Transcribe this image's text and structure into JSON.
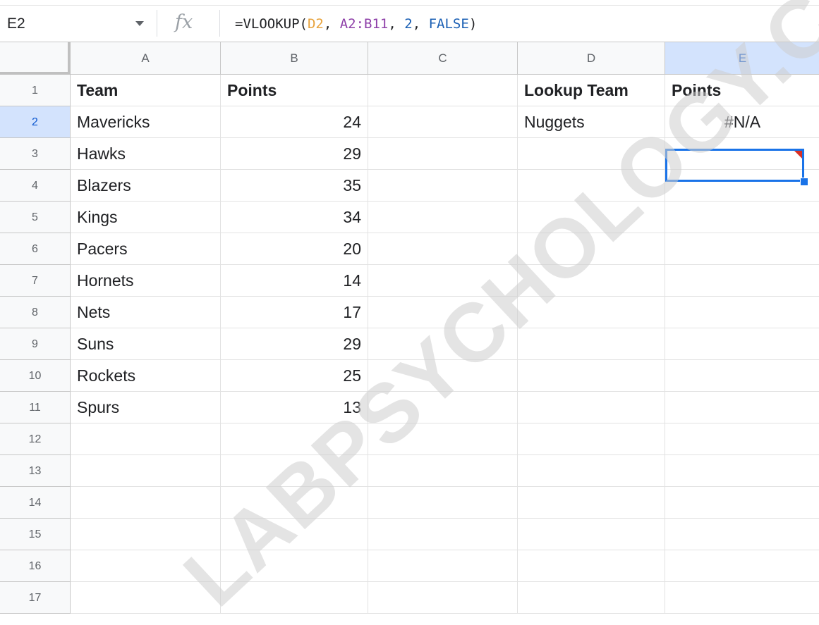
{
  "formula_bar": {
    "name_box": "E2",
    "fx_label": "fx",
    "formula_parts": [
      {
        "text": "=VLOOKUP(",
        "color": "#202124"
      },
      {
        "text": "D2",
        "color": "#e8a33d"
      },
      {
        "text": ", ",
        "color": "#202124"
      },
      {
        "text": "A2:B11",
        "color": "#8e3fa8"
      },
      {
        "text": ", ",
        "color": "#202124"
      },
      {
        "text": "2",
        "color": "#1a5fb4"
      },
      {
        "text": ", ",
        "color": "#202124"
      },
      {
        "text": "FALSE",
        "color": "#1a5fb4"
      },
      {
        "text": ")",
        "color": "#202124"
      }
    ]
  },
  "sheet": {
    "columns": [
      "A",
      "B",
      "C",
      "D",
      "E"
    ],
    "active_column": "E",
    "active_row": 2,
    "rows": [
      {
        "num": "1",
        "A": "Team",
        "B": "Points",
        "C": "",
        "D": "Lookup Team",
        "E": "Points"
      },
      {
        "num": "2",
        "A": "Mavericks",
        "B": "24",
        "C": "",
        "D": "Nuggets",
        "E": "#N/A"
      },
      {
        "num": "3",
        "A": "Hawks",
        "B": "29",
        "C": "",
        "D": "",
        "E": ""
      },
      {
        "num": "4",
        "A": "Blazers",
        "B": "35",
        "C": "",
        "D": "",
        "E": ""
      },
      {
        "num": "5",
        "A": "Kings",
        "B": "34",
        "C": "",
        "D": "",
        "E": ""
      },
      {
        "num": "6",
        "A": "Pacers",
        "B": "20",
        "C": "",
        "D": "",
        "E": ""
      },
      {
        "num": "7",
        "A": "Hornets",
        "B": "14",
        "C": "",
        "D": "",
        "E": ""
      },
      {
        "num": "8",
        "A": "Nets",
        "B": "17",
        "C": "",
        "D": "",
        "E": ""
      },
      {
        "num": "9",
        "A": "Suns",
        "B": "29",
        "C": "",
        "D": "",
        "E": ""
      },
      {
        "num": "10",
        "A": "Rockets",
        "B": "25",
        "C": "",
        "D": "",
        "E": ""
      },
      {
        "num": "11",
        "A": "Spurs",
        "B": "13",
        "C": "",
        "D": "",
        "E": ""
      },
      {
        "num": "12",
        "A": "",
        "B": "",
        "C": "",
        "D": "",
        "E": ""
      },
      {
        "num": "13",
        "A": "",
        "B": "",
        "C": "",
        "D": "",
        "E": ""
      },
      {
        "num": "14",
        "A": "",
        "B": "",
        "C": "",
        "D": "",
        "E": ""
      },
      {
        "num": "15",
        "A": "",
        "B": "",
        "C": "",
        "D": "",
        "E": ""
      },
      {
        "num": "16",
        "A": "",
        "B": "",
        "C": "",
        "D": "",
        "E": ""
      },
      {
        "num": "17",
        "A": "",
        "B": "",
        "C": "",
        "D": "",
        "E": ""
      }
    ]
  },
  "watermark": "LABPSYCHOLOGY.COM",
  "icons": {
    "name_box_dropdown": "caret-down-icon",
    "function": "fx-icon"
  }
}
